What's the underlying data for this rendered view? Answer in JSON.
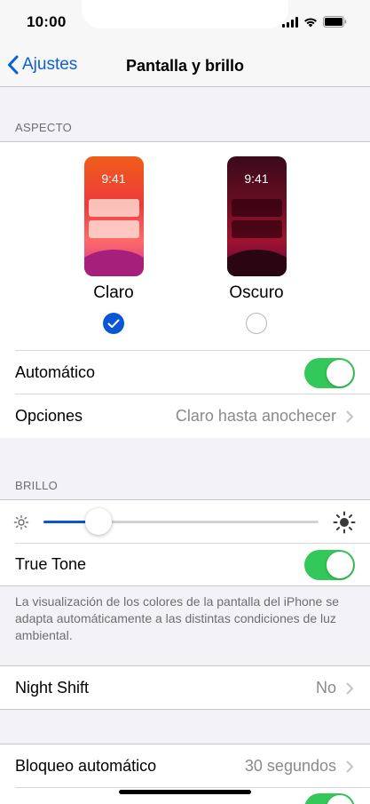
{
  "status_bar": {
    "time": "10:00"
  },
  "nav": {
    "back_label": "Ajustes",
    "title": "Pantalla y brillo"
  },
  "appearance": {
    "header": "ASPECTO",
    "options": [
      {
        "label": "Claro",
        "preview_time": "9:41",
        "selected": true
      },
      {
        "label": "Oscuro",
        "preview_time": "9:41",
        "selected": false
      }
    ],
    "automatic_label": "Automático",
    "automatic_on": true,
    "options_label": "Opciones",
    "options_value": "Claro hasta anochecer"
  },
  "brightness": {
    "header": "BRILLO",
    "level": 0.2,
    "true_tone_label": "True Tone",
    "true_tone_on": true,
    "footnote": "La visualización de los colores de la pantalla del iPhone se adapta automáticamente a las distintas condiciones de luz ambiental."
  },
  "night_shift": {
    "label": "Night Shift",
    "value": "No"
  },
  "auto_lock": {
    "label": "Bloqueo automático",
    "value": "30 segundos"
  },
  "colors": {
    "accent": "#0a56d6",
    "toggle_on": "#34c759",
    "secondary_text": "#8a8a8e"
  }
}
